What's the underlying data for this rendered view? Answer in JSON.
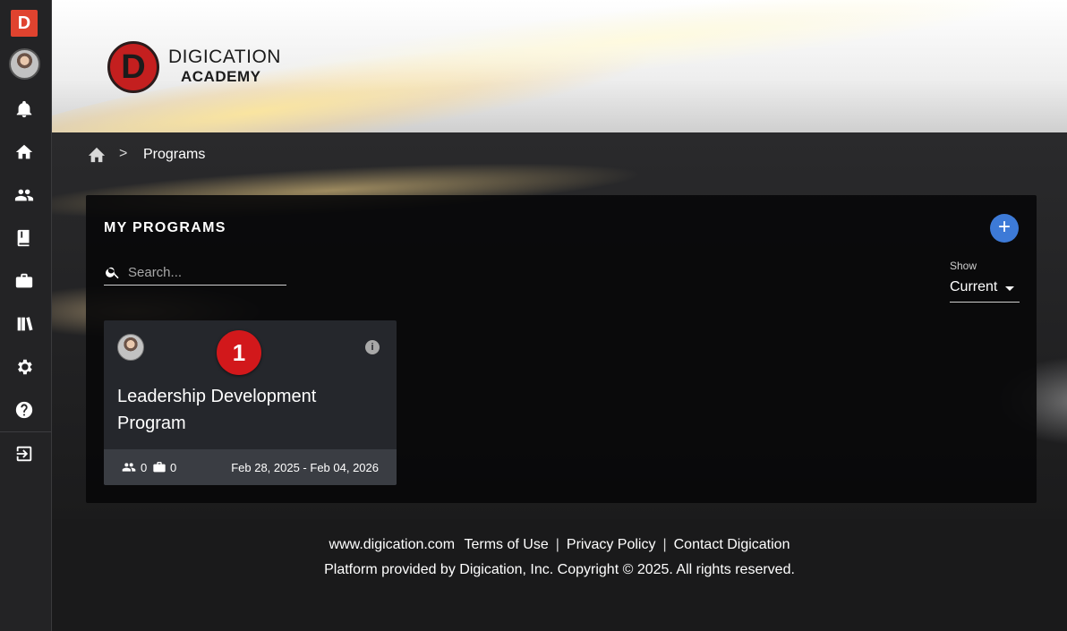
{
  "sidebar": {
    "logo_letter": "D",
    "icons": [
      "bell-icon",
      "home-icon",
      "people-icon",
      "book-icon",
      "briefcase-icon",
      "books-icon",
      "settings-icon",
      "help-icon",
      "logout-icon"
    ]
  },
  "brand": {
    "line1": "DIGICATION",
    "line2": "ACADEMY",
    "mark": "D"
  },
  "breadcrumb": {
    "separator": ">",
    "current": "Programs"
  },
  "panel": {
    "title": "MY PROGRAMS",
    "add_label": "+",
    "search_placeholder": "Search...",
    "show_label": "Show",
    "show_value": "Current"
  },
  "programs": [
    {
      "badge": "1",
      "info": "i",
      "title": "Leadership Development Program",
      "members": "0",
      "portfolios": "0",
      "dates": "Feb 28, 2025 - Feb 04, 2026"
    }
  ],
  "footer": {
    "site": "www.digication.com",
    "terms": "Terms of Use",
    "divider": "|",
    "privacy": "Privacy Policy",
    "contact": "Contact Digication",
    "copyright": "Platform provided by Digication, Inc. Copyright © 2025. All rights reserved."
  },
  "colors": {
    "accent_blue": "#3d7ad7",
    "badge_red": "#d2181b",
    "logo_orange": "#e0432f",
    "card_bg": "#25272c"
  }
}
